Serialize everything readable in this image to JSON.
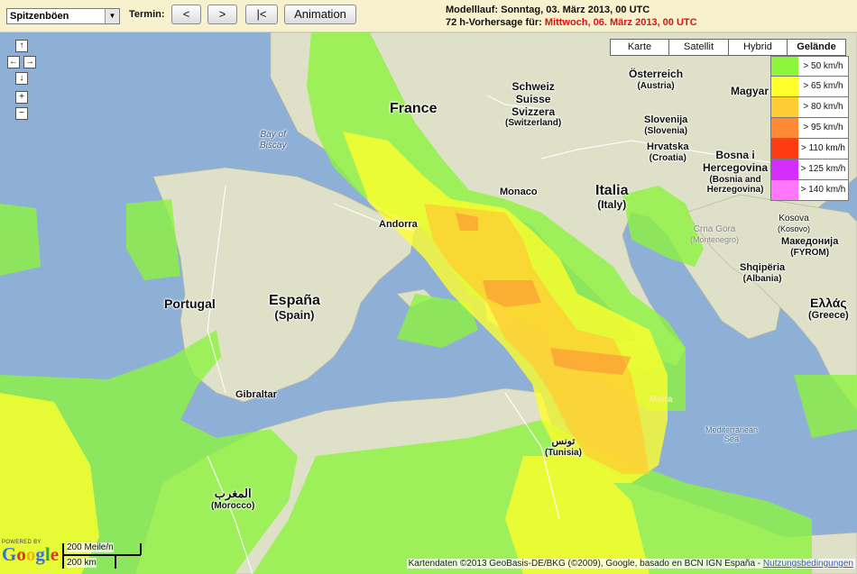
{
  "toolbar": {
    "parameter_value": "Spitzenböen",
    "termin_label": "Termin:",
    "prev_label": "<",
    "next_label": ">",
    "first_label": "|<",
    "animation_label": "Animation",
    "modelllauf_prefix": "Modelllauf:",
    "modelllauf_value": "Sonntag, 03. März 2013, 00 UTC",
    "forecast_prefix": "72 h-Vorhersage für:",
    "forecast_value": "Mittwoch, 06. März 2013, 00 UTC"
  },
  "map_types": [
    "Karte",
    "Satellit",
    "Hybrid",
    "Gelände"
  ],
  "active_map_type": "Gelände",
  "legend": [
    {
      "label": "> 50 km/h",
      "color": "#8cf53c"
    },
    {
      "label": "> 65 km/h",
      "color": "#ffff2a"
    },
    {
      "label": "> 80 km/h",
      "color": "#ffcc33"
    },
    {
      "label": "> 95 km/h",
      "color": "#ff8a33"
    },
    {
      "label": "> 110 km/h",
      "color": "#ff3b14"
    },
    {
      "label": "> 125 km/h",
      "color": "#d42eff"
    },
    {
      "label": "> 140 km/h",
      "color": "#ff77ff"
    }
  ],
  "nav_controls": {
    "up": "↑",
    "left": "←",
    "right": "→",
    "down": "↓",
    "zoom_in": "+",
    "zoom_out": "−"
  },
  "labels": {
    "france": "France",
    "schweiz": "Schweiz",
    "suisse": "Suisse",
    "svizzera": "Svizzera",
    "switzerland": "(Switzerland)",
    "osterreich": "Österreich",
    "austria": "(Austria)",
    "magyar": "Magyar",
    "slovenija": "Slovenija",
    "slovenia": "(Slovenia)",
    "hrvatska": "Hrvatska",
    "croatia": "(Croatia)",
    "bosna": "Bosna i",
    "hercegovina": "Hercegovina",
    "bosnia": "(Bosnia and",
    "herzegovina": "Herzegovina)",
    "italia": "Italia",
    "italy": "(Italy)",
    "monaco": "Monaco",
    "andorra": "Andorra",
    "bay_of_biscay": "Bay of",
    "biscay": "Biscay",
    "portugal": "Portugal",
    "espana": "España",
    "spain": "(Spain)",
    "gibraltar": "Gibraltar",
    "morocco_ar": "المغرب",
    "morocco": "(Morocco)",
    "tunisia_ar": "تونس",
    "tunisia": "(Tunisia)",
    "crna_gora": "Crna Gora",
    "montenegro": "(Montenegro)",
    "kosova": "Kosova",
    "kosovo": "(Kosovo)",
    "makedonija": "Македонија",
    "fyrom": "(FYROM)",
    "shqiperia": "Shqipëria",
    "albania": "(Albania)",
    "ellas": "Ελλάς",
    "greece": "(Greece)",
    "malta": "Malta",
    "med_sea1": "Mediterranean",
    "med_sea2": "Sea"
  },
  "footer": {
    "powered_by": "POWERED BY",
    "google": "Google",
    "scale_miles": "200 Meile/n",
    "scale_km": "200 km",
    "attribution": "Kartendaten ©2013 GeoBasis-DE/BKG (©2009), Google, basado en BCN IGN España - ",
    "terms_link": "Nutzungsbedingungen"
  }
}
